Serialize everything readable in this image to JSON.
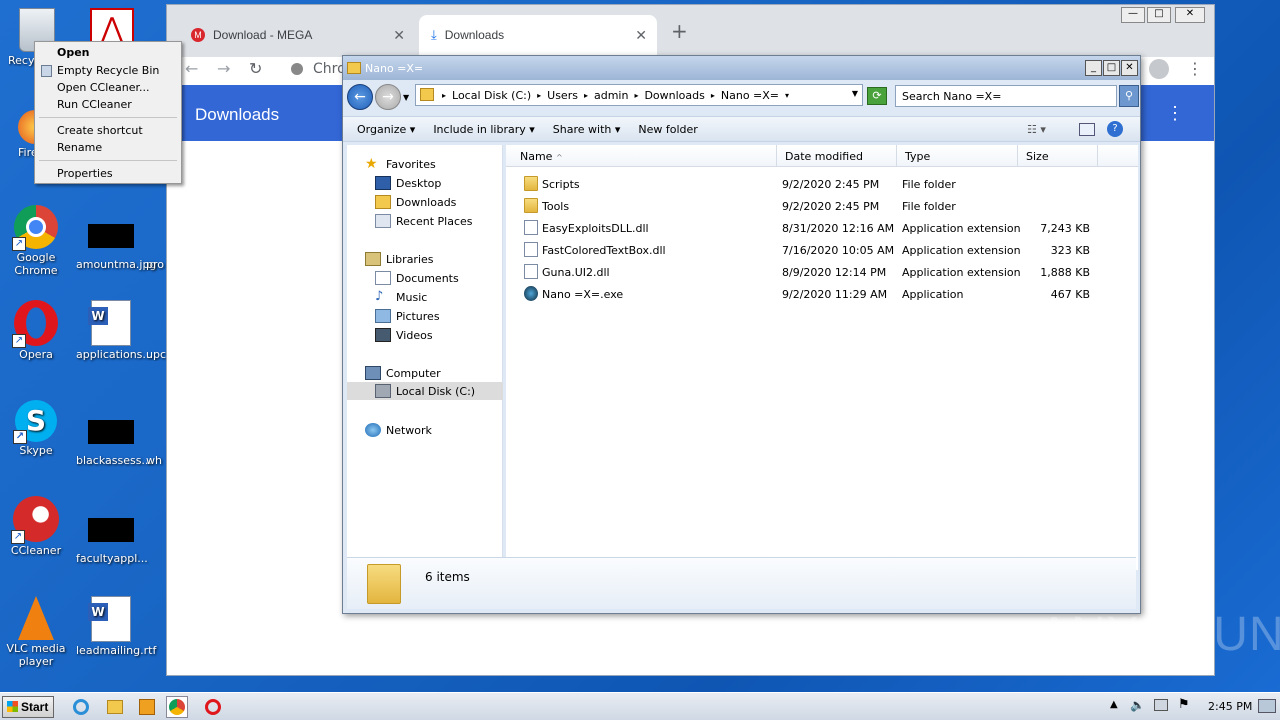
{
  "desktop": {
    "icons": [
      {
        "label": "Recy"
      },
      {
        "label": "Fire"
      },
      {
        "label": "Google Chrome"
      },
      {
        "label": "amountma.jpg"
      },
      {
        "label": "pro"
      },
      {
        "label": "Opera"
      },
      {
        "label": "applications..."
      },
      {
        "label": "upc"
      },
      {
        "label": "Skype"
      },
      {
        "label": "blackassess..."
      },
      {
        "label": "wh"
      },
      {
        "label": "CCleaner"
      },
      {
        "label": "facultyappl..."
      },
      {
        "label": "VLC media player"
      },
      {
        "label": "leadmailing.rtf"
      }
    ]
  },
  "context_menu": {
    "items": [
      "Open",
      "Empty Recycle Bin",
      "Open CCleaner...",
      "Run CCleaner",
      "Create shortcut",
      "Rename",
      "Properties"
    ]
  },
  "chrome": {
    "tabs": [
      {
        "title": "Download - MEGA",
        "close": "✕"
      },
      {
        "title": "Downloads",
        "close": "✕"
      }
    ],
    "new_tab": "+",
    "omnibox_text": "Chro",
    "page_title": "Downloads",
    "window_controls": [
      "—",
      "□",
      "✕"
    ]
  },
  "explorer": {
    "title": "Nano =X=",
    "path": [
      "Local Disk (C:)",
      "Users",
      "admin",
      "Downloads",
      "Nano =X="
    ],
    "search_placeholder": "Search Nano =X=",
    "commands": [
      "Organize",
      "Include in library",
      "Share with",
      "New folder"
    ],
    "nav": {
      "favorites_label": "Favorites",
      "favorites": [
        "Desktop",
        "Downloads",
        "Recent Places"
      ],
      "libraries_label": "Libraries",
      "libraries": [
        "Documents",
        "Music",
        "Pictures",
        "Videos"
      ],
      "computer_label": "Computer",
      "computer": [
        "Local Disk (C:)"
      ],
      "network_label": "Network"
    },
    "columns": [
      "Name",
      "Date modified",
      "Type",
      "Size"
    ],
    "files": [
      {
        "name": "Scripts",
        "date": "9/2/2020 2:45 PM",
        "type": "File folder",
        "size": "",
        "kind": "folder"
      },
      {
        "name": "Tools",
        "date": "9/2/2020 2:45 PM",
        "type": "File folder",
        "size": "",
        "kind": "folder"
      },
      {
        "name": "EasyExploitsDLL.dll",
        "date": "8/31/2020 12:16 AM",
        "type": "Application extension",
        "size": "7,243 KB",
        "kind": "dll"
      },
      {
        "name": "FastColoredTextBox.dll",
        "date": "7/16/2020 10:05 AM",
        "type": "Application extension",
        "size": "323 KB",
        "kind": "dll"
      },
      {
        "name": "Guna.UI2.dll",
        "date": "8/9/2020 12:14 PM",
        "type": "Application extension",
        "size": "1,888 KB",
        "kind": "dll"
      },
      {
        "name": "Nano =X=.exe",
        "date": "9/2/2020 11:29 AM",
        "type": "Application",
        "size": "467 KB",
        "kind": "exe"
      }
    ],
    "item_count": "6 items"
  },
  "taskbar": {
    "start_label": "Start",
    "clock": "2:45 PM"
  },
  "watermark": "ANY▷RUN"
}
